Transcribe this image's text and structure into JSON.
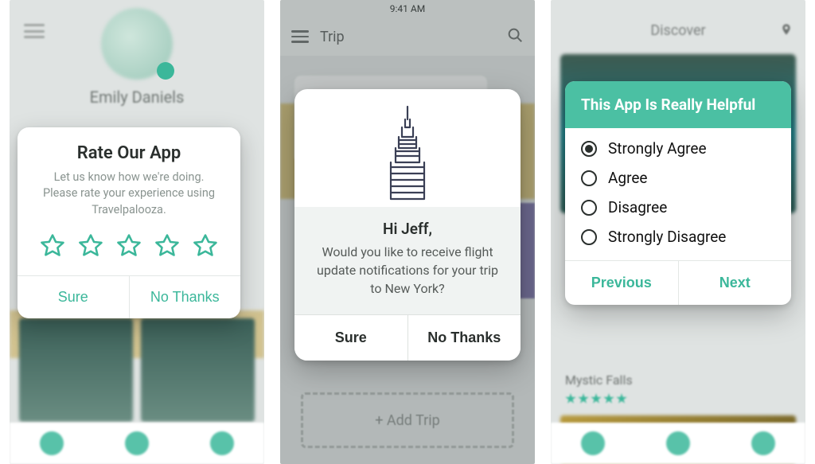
{
  "colors": {
    "accent": "#3bb79a",
    "accent2": "#4bc0a3"
  },
  "phone1": {
    "bg": {
      "user_name": "Emily Daniels"
    },
    "card": {
      "title": "Rate Our App",
      "body": "Let us know how we're doing. Please rate your experience using Travelpalooza.",
      "star_count": 5,
      "buttons": {
        "confirm": "Sure",
        "dismiss": "No Thanks"
      }
    }
  },
  "phone2": {
    "status_time": "9:41 AM",
    "toolbar": {
      "title": "Trip",
      "menu_icon": "hamburger-icon",
      "search_icon": "search-icon"
    },
    "bg": {
      "add_trip_label": "+  Add Trip"
    },
    "card": {
      "illustration": "empire-state-icon",
      "greeting": "Hi Jeff,",
      "body": "Would you like to receive flight update notifications for your trip to New York?",
      "buttons": {
        "confirm": "Sure",
        "dismiss": "No Thanks"
      }
    }
  },
  "phone3": {
    "bg": {
      "header": "Discover",
      "pin_icon": "map-pin-icon",
      "caption": "Mystic Falls"
    },
    "card": {
      "title": "This App Is Really Helpful",
      "options": [
        {
          "label": "Strongly Agree",
          "selected": true
        },
        {
          "label": "Agree",
          "selected": false
        },
        {
          "label": "Disagree",
          "selected": false
        },
        {
          "label": "Strongly Disagree",
          "selected": false
        }
      ],
      "buttons": {
        "prev": "Previous",
        "next": "Next"
      }
    }
  }
}
